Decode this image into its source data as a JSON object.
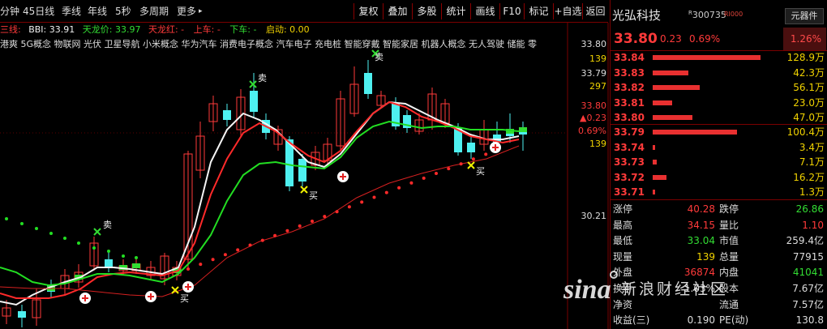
{
  "toolbar": {
    "left_items": [
      "分钟",
      "45日线",
      "季线",
      "年线",
      "5秒",
      "多周期",
      "更多"
    ],
    "more_arrow": "▸",
    "buttons": [
      "复权",
      "叠加",
      "多股",
      "统计",
      "画线",
      "F10",
      "标记",
      "+自选",
      "返回"
    ]
  },
  "indicator": {
    "prefix": "三线:",
    "bbi_label": "BBI: 33.91",
    "tianlong_label": "天龙价: 33.97",
    "tianlonghong_label": "天龙红: -",
    "up_label": "上车: -",
    "down_label": "下车: -",
    "start_label": "启动: 0.00"
  },
  "concepts": "港爽 5G概念 物联网 光伏 卫星导航 小米概念 华为汽车 消费电子概念 汽车电子 充电桩 智能穿戴 智能家居 机器人概念 无人驾驶 储能 零",
  "axis": {
    "top_price": "33.80",
    "vol1": "139",
    "p2": "33.79",
    "vol2": "297",
    "p3": "33.80",
    "chg": "▲0.23",
    "pct": "0.69%",
    "vol3": "139",
    "low": "30.21"
  },
  "chart_labels": {
    "buy": "买",
    "sell": "卖",
    "sell_top": "卖"
  },
  "stock": {
    "name": "光弘科技",
    "code_prefix": "R",
    "code": "300735",
    "r_badge": "RI000",
    "sector_btn": "元器件",
    "price": "33.80",
    "change": "0.23",
    "pct": "0.69%",
    "side_pct": "1.26%"
  },
  "orderbook": {
    "asks": [
      {
        "price": "33.84",
        "vol": "128.9万",
        "frac": 0.78
      },
      {
        "price": "33.83",
        "vol": "42.3万",
        "frac": 0.26
      },
      {
        "price": "33.82",
        "vol": "56.1万",
        "frac": 0.34
      },
      {
        "price": "33.81",
        "vol": "23.0万",
        "frac": 0.14
      },
      {
        "price": "33.80",
        "vol": "47.0万",
        "frac": 0.29
      }
    ],
    "bids": [
      {
        "price": "33.79",
        "vol": "100.4万",
        "frac": 0.61
      },
      {
        "price": "33.74",
        "vol": "3.4万",
        "frac": 0.02
      },
      {
        "price": "33.73",
        "vol": "7.1万",
        "frac": 0.03
      },
      {
        "price": "33.72",
        "vol": "16.2万",
        "frac": 0.1
      },
      {
        "price": "33.71",
        "vol": "1.3万",
        "frac": 0.01
      }
    ]
  },
  "stats": [
    {
      "l1": "涨停",
      "v1": "40.28",
      "c1": "#ff3a3a",
      "l2": "跌停",
      "v2": "26.86",
      "c2": "#33dd33"
    },
    {
      "l1": "最高",
      "v1": "34.15",
      "c1": "#ff3a3a",
      "l2": "量比",
      "v2": "1.10",
      "c2": "#ff3a3a"
    },
    {
      "l1": "最低",
      "v1": "33.04",
      "c1": "#33dd33",
      "l2": "市值",
      "v2": "259.4亿",
      "c2": "#dddddd"
    },
    {
      "l1": "现量",
      "v1": "139",
      "c1": "#f0d200",
      "l2": "总量",
      "v2": "77915",
      "c2": "#dddddd"
    },
    {
      "l1": "外盘",
      "v1": "36874",
      "c1": "#ff3a3a",
      "l2": "内盘",
      "v2": "41041",
      "c2": "#33dd33"
    },
    {
      "l1": "换手",
      "v1": "1.03%",
      "c1": "#dddddd",
      "l2": "股本",
      "v2": "7.67亿",
      "c2": "#dddddd"
    },
    {
      "l1": "净资",
      "v1": "",
      "c1": "#dddddd",
      "l2": "流通",
      "v2": "7.57亿",
      "c2": "#dddddd"
    },
    {
      "l1": "收益(三)",
      "v1": "0.190",
      "c1": "#dddddd",
      "l2": "PE(动)",
      "v2": "130.8",
      "c2": "#dddddd"
    }
  ],
  "watermark": {
    "logo": "sina",
    "text": "新浪财经社区"
  },
  "colors": {
    "up": "#ff3a3a",
    "down": "#33dd33",
    "yellow": "#f0d200",
    "cyan": "#4ef0f0",
    "border": "#7a0000"
  }
}
